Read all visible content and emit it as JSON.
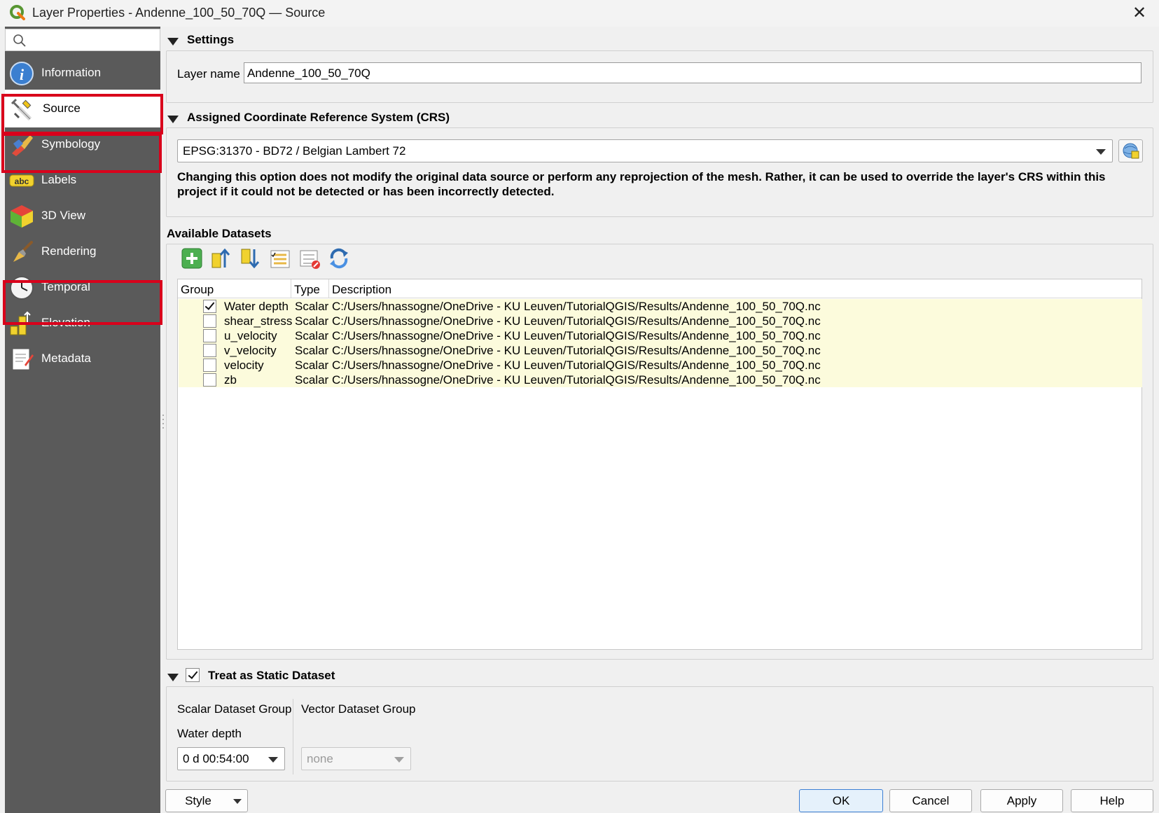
{
  "window": {
    "title": "Layer Properties - Andenne_100_50_70Q — Source",
    "close_glyph": "✕"
  },
  "sidebar": {
    "search_placeholder": "",
    "items": [
      {
        "label": "Information",
        "icon": "information-icon"
      },
      {
        "label": "Source",
        "icon": "source-icon"
      },
      {
        "label": "Symbology",
        "icon": "symbology-icon"
      },
      {
        "label": "Labels",
        "icon": "labels-icon",
        "icon_text": "abc"
      },
      {
        "label": "3D View",
        "icon": "3d-view-icon"
      },
      {
        "label": "Rendering",
        "icon": "rendering-icon"
      },
      {
        "label": "Temporal",
        "icon": "temporal-icon"
      },
      {
        "label": "Elevation",
        "icon": "elevation-icon"
      },
      {
        "label": "Metadata",
        "icon": "metadata-icon"
      }
    ],
    "selected": "Source",
    "highlighted": [
      "Source",
      "Symbology",
      "Temporal"
    ],
    "highlight_color": "#d9001b"
  },
  "settings": {
    "header": "Settings",
    "layer_name_label": "Layer name",
    "layer_name_value": "Andenne_100_50_70Q"
  },
  "crs": {
    "header": "Assigned Coordinate Reference System (CRS)",
    "value": "EPSG:31370 - BD72 / Belgian Lambert 72",
    "warning": "Changing this option does not modify the original data source or perform any reprojection of the mesh. Rather, it can be used to override the layer's CRS within this project if it could not be detected or has been incorrectly detected."
  },
  "datasets": {
    "header": "Available Datasets",
    "toolbar": [
      "add-dataset-icon",
      "collapse-all-icon",
      "expand-all-icon",
      "check-all-icon",
      "uncheck-all-icon",
      "reload-icon"
    ],
    "columns": [
      "Group",
      "Type",
      "Description"
    ],
    "rows": [
      {
        "group": "Water depth",
        "type": "Scalar",
        "description": "C:/Users/hnassogne/OneDrive - KU Leuven/TutorialQGIS/Results/Andenne_100_50_70Q.nc",
        "checked": true
      },
      {
        "group": "shear_stress",
        "type": "Scalar",
        "description": "C:/Users/hnassogne/OneDrive - KU Leuven/TutorialQGIS/Results/Andenne_100_50_70Q.nc",
        "checked": false
      },
      {
        "group": "u_velocity",
        "type": "Scalar",
        "description": "C:/Users/hnassogne/OneDrive - KU Leuven/TutorialQGIS/Results/Andenne_100_50_70Q.nc",
        "checked": false
      },
      {
        "group": "v_velocity",
        "type": "Scalar",
        "description": "C:/Users/hnassogne/OneDrive - KU Leuven/TutorialQGIS/Results/Andenne_100_50_70Q.nc",
        "checked": false
      },
      {
        "group": "velocity",
        "type": "Scalar",
        "description": "C:/Users/hnassogne/OneDrive - KU Leuven/TutorialQGIS/Results/Andenne_100_50_70Q.nc",
        "checked": false
      },
      {
        "group": "zb",
        "type": "Scalar",
        "description": "C:/Users/hnassogne/OneDrive - KU Leuven/TutorialQGIS/Results/Andenne_100_50_70Q.nc",
        "checked": false
      }
    ],
    "row_highlight_color": "#fcfbdc"
  },
  "static_dataset": {
    "header": "Treat as Static Dataset",
    "checked": true,
    "scalar_group_label": "Scalar Dataset Group",
    "scalar_group_value": "Water depth",
    "scalar_time_value": "0 d 00:54:00",
    "vector_group_label": "Vector Dataset Group",
    "vector_value": "none"
  },
  "buttons": {
    "style": "Style",
    "ok": "OK",
    "cancel": "Cancel",
    "apply": "Apply",
    "help": "Help"
  }
}
